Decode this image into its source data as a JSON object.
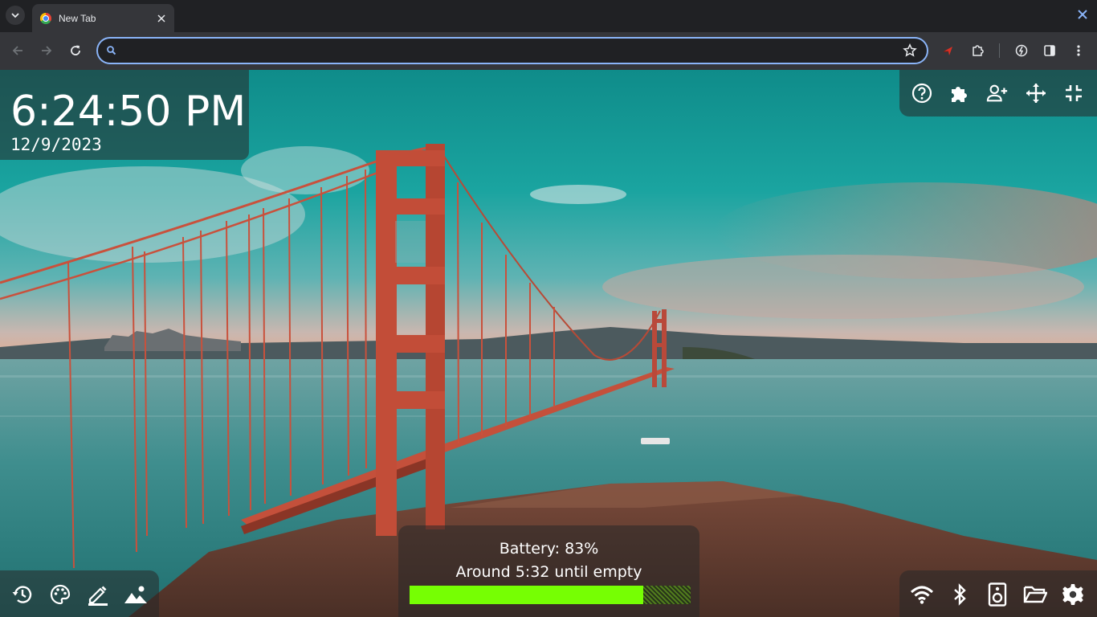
{
  "browser": {
    "tab_title": "New Tab",
    "omnibox": {
      "value": "",
      "placeholder": ""
    },
    "icons": {
      "tab_search": "chevron-down-icon",
      "tab_close": "close-icon",
      "window_close": "close-icon",
      "back": "arrow-left-icon",
      "forward": "arrow-right-icon",
      "reload": "reload-icon",
      "bookmark": "star-icon",
      "extension_1": "red-arrow-extension-icon",
      "extensions": "puzzle-icon",
      "performance": "speed-icon",
      "side_panel": "side-panel-icon",
      "menu": "kebab-menu-icon"
    }
  },
  "clock": {
    "time": "6:24:50 PM",
    "date": "12/9/2023"
  },
  "top_tools": [
    "help-icon",
    "puzzle-icon",
    "add-person-icon",
    "move-icon",
    "fullscreen-exit-icon"
  ],
  "battery": {
    "status": "Battery: 83%",
    "estimate": "Around 5:32 until empty",
    "level": 0.83,
    "fill_color": "#76ff03"
  },
  "bottom_left_tools": [
    "history-icon",
    "palette-icon",
    "edit-icon",
    "image-icon"
  ],
  "bottom_right_tools": [
    "wifi-icon",
    "bluetooth-icon",
    "speaker-icon",
    "folder-icon",
    "settings-icon"
  ],
  "colors": {
    "chrome_dark": "#202124",
    "chrome_toolbar": "#35363a",
    "focus_ring": "#8ab4f8"
  }
}
